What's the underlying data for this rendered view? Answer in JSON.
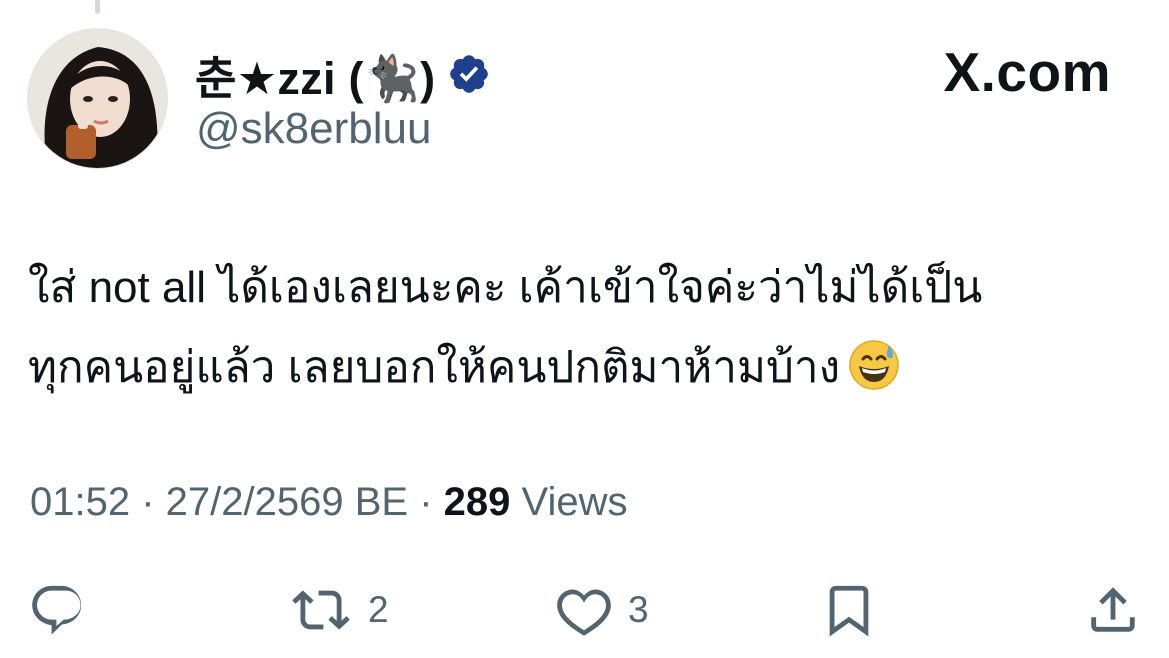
{
  "tweet": {
    "author": {
      "display_name": "춘★zzi (🐈‍⬛)",
      "handle": "@sk8erbluu",
      "verified": true
    },
    "brand": "X.com",
    "text": "ใส่ not all ได้เองเลยนะคะ เค้าเข้าใจค่ะว่าไม่ได้เป็น\nทุกคนอยู่แล้ว เลยบอกให้คนปกติมาห้ามบ้าง",
    "text_emoji": "grinning-face-with-sweat",
    "meta": {
      "time": "01:52",
      "sep1": " · ",
      "date": "27/2/2569 BE",
      "sep2": " · ",
      "views_count": "289",
      "views_label": " Views"
    },
    "actions": {
      "reply_icon": "reply-icon",
      "retweet_icon": "retweet-icon",
      "retweet_count": "2",
      "like_icon": "heart-icon",
      "like_count": "3",
      "bookmark_icon": "bookmark-icon",
      "share_icon": "share-icon"
    }
  },
  "colors": {
    "text": "#0f1419",
    "secondary": "#536471",
    "verified": "#1d9bf0",
    "verified_dark": "#1f3f8f"
  }
}
